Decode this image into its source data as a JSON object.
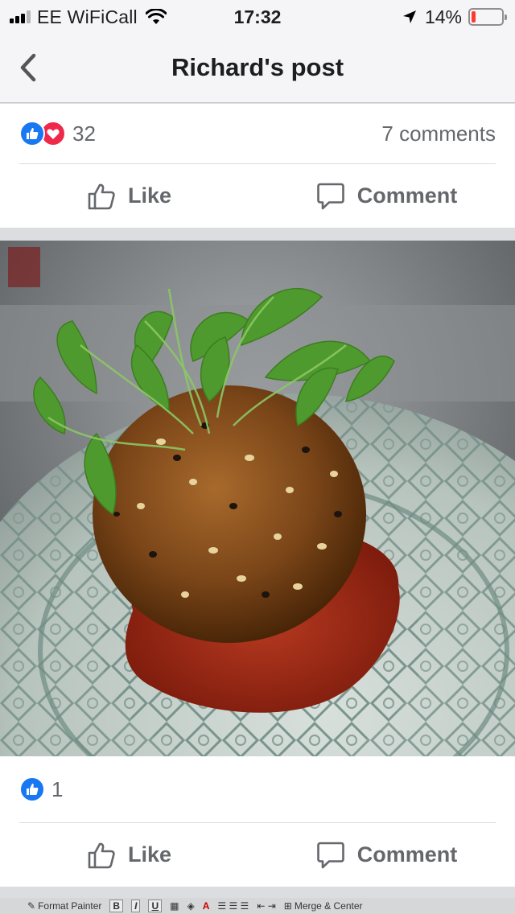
{
  "status_bar": {
    "carrier": "EE WiFiCall",
    "time": "17:32",
    "battery_percent": "14%",
    "battery_level": 0.14,
    "battery_color": "#ff3b30"
  },
  "nav": {
    "title": "Richard's post",
    "back_icon": "chevron-left-icon"
  },
  "post": {
    "reaction_count": "32",
    "reactions": [
      "like",
      "love"
    ],
    "comments_count": "7 comments",
    "actions": {
      "like_label": "Like",
      "comment_label": "Comment"
    }
  },
  "photo": {
    "reaction_count": "1",
    "reactions": [
      "like"
    ],
    "actions": {
      "like_label": "Like",
      "comment_label": "Comment"
    }
  },
  "bottom_toolbar": {
    "format_painter": "Format Painter",
    "bold": "B",
    "italic": "I",
    "underline": "U",
    "merge_center": "Merge & Center"
  },
  "colors": {
    "like_blue": "#1877f2",
    "love_red": "#f0284a",
    "action_gray": "#65676b"
  }
}
